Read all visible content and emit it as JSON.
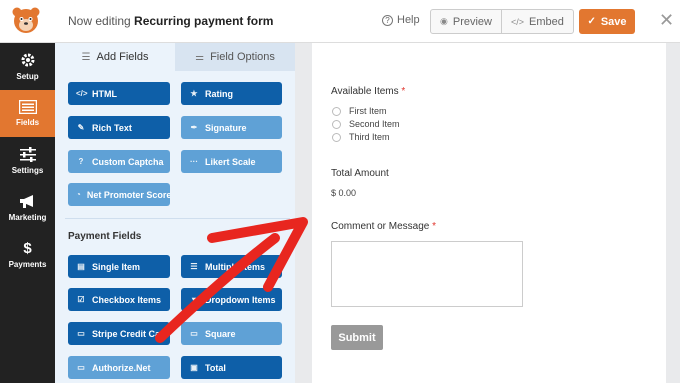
{
  "header": {
    "title_prefix": "Now editing",
    "form_name": "Recurring payment form",
    "help_label": "Help",
    "preview_label": "Preview",
    "embed_label": "Embed",
    "save_label": "Save",
    "accent_color": "#e27730"
  },
  "rail": {
    "items": [
      {
        "label": "Setup",
        "icon": "gear-icon",
        "active": false
      },
      {
        "label": "Fields",
        "icon": "list-icon",
        "active": true
      },
      {
        "label": "Settings",
        "icon": "sliders-icon",
        "active": false
      },
      {
        "label": "Marketing",
        "icon": "megaphone-icon",
        "active": false
      },
      {
        "label": "Payments",
        "icon": "dollar-icon",
        "active": false
      }
    ]
  },
  "panel": {
    "tabs": {
      "add_fields": "Add Fields",
      "field_options": "Field Options"
    },
    "fancy_fields": [
      {
        "label": "HTML",
        "icon": "code-icon",
        "style": "dark"
      },
      {
        "label": "Rating",
        "icon": "star-icon",
        "style": "dark"
      },
      {
        "label": "Rich Text",
        "icon": "edit-icon",
        "style": "dark"
      },
      {
        "label": "Signature",
        "icon": "pen-icon",
        "style": "light"
      },
      {
        "label": "Custom Captcha",
        "icon": "question-icon",
        "style": "light"
      },
      {
        "label": "Likert Scale",
        "icon": "ellipsis-icon",
        "style": "light"
      },
      {
        "label": "Net Promoter Score",
        "icon": "gauge-icon",
        "style": "light"
      }
    ],
    "payment_section_title": "Payment Fields",
    "payment_fields": [
      {
        "label": "Single Item",
        "icon": "file-icon",
        "style": "dark"
      },
      {
        "label": "Multiple Items",
        "icon": "list-icon",
        "style": "dark"
      },
      {
        "label": "Checkbox Items",
        "icon": "checkbox-icon",
        "style": "dark"
      },
      {
        "label": "Dropdown Items",
        "icon": "dropdown-icon",
        "style": "dark"
      },
      {
        "label": "Stripe Credit Card",
        "icon": "card-icon",
        "style": "dark"
      },
      {
        "label": "Square",
        "icon": "card-icon",
        "style": "light"
      },
      {
        "label": "Authorize.Net",
        "icon": "card-icon",
        "style": "light"
      },
      {
        "label": "Total",
        "icon": "money-icon",
        "style": "dark"
      }
    ]
  },
  "form": {
    "available_items_label": "Available Items",
    "required_mark": "*",
    "options": [
      "First Item",
      "Second Item",
      "Third Item"
    ],
    "total_label": "Total Amount",
    "total_value": "$ 0.00",
    "comment_label": "Comment or Message",
    "submit_label": "Submit"
  }
}
